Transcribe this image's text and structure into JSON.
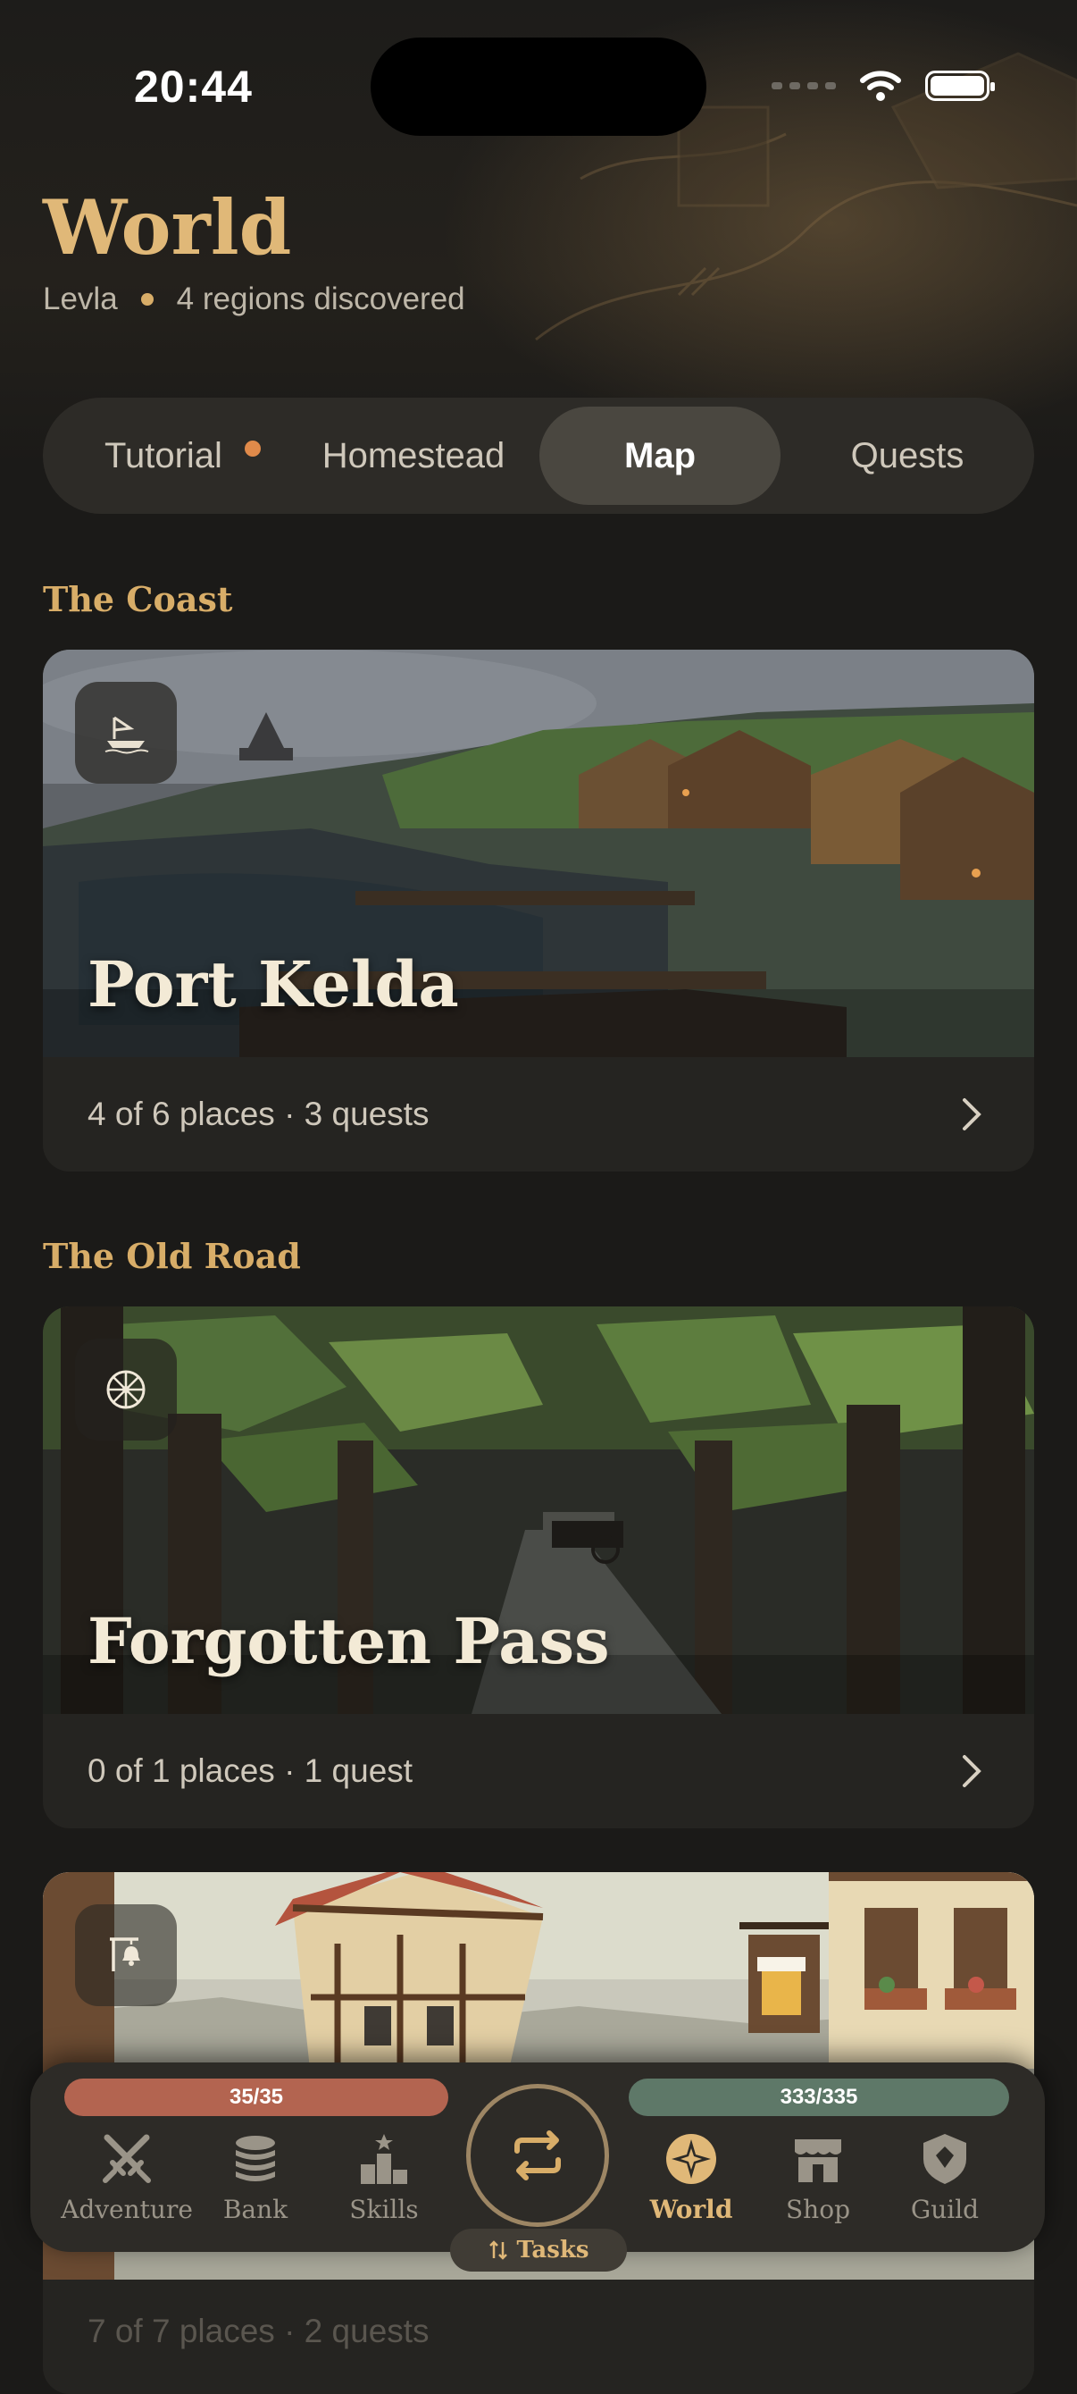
{
  "status_bar": {
    "time": "20:44"
  },
  "header": {
    "title": "World",
    "character": "Levla",
    "regions_text": "4 regions discovered"
  },
  "tabs": [
    {
      "label": "Tutorial",
      "has_notification": true
    },
    {
      "label": "Homestead"
    },
    {
      "label": "Map",
      "active": true
    },
    {
      "label": "Quests"
    }
  ],
  "sections": [
    {
      "label": "The Coast",
      "card": {
        "title": "Port Kelda",
        "meta": "4 of 6 places · 3 quests",
        "badge_icon": "boat-icon"
      }
    },
    {
      "label": "The Old Road",
      "card": {
        "title": "Forgotten Pass",
        "meta": "0 of 1 places · 1 quest",
        "badge_icon": "wagon-wheel-icon"
      }
    },
    {
      "label": "",
      "card": {
        "title": "",
        "meta": "7 of 7 places · 2 quests",
        "badge_icon": "bell-icon"
      }
    }
  ],
  "bottom_nav": {
    "hp_text": "35/35",
    "xp_text": "333/335",
    "items": [
      {
        "label": "Adventure",
        "icon": "crossed-swords-icon"
      },
      {
        "label": "Bank",
        "icon": "coin-stack-icon"
      },
      {
        "label": "Skills",
        "icon": "podium-icon"
      },
      {
        "label": "World",
        "icon": "compass-star-icon",
        "active": true
      },
      {
        "label": "Shop",
        "icon": "shop-icon"
      },
      {
        "label": "Guild",
        "icon": "shield-icon"
      }
    ],
    "center_icon": "repeat-icon",
    "tasks_label": "Tasks"
  },
  "colors": {
    "accent_gold": "#e0b878",
    "background": "#1b1a18",
    "hp_bar": "#b36450",
    "xp_bar": "#5e7868"
  }
}
